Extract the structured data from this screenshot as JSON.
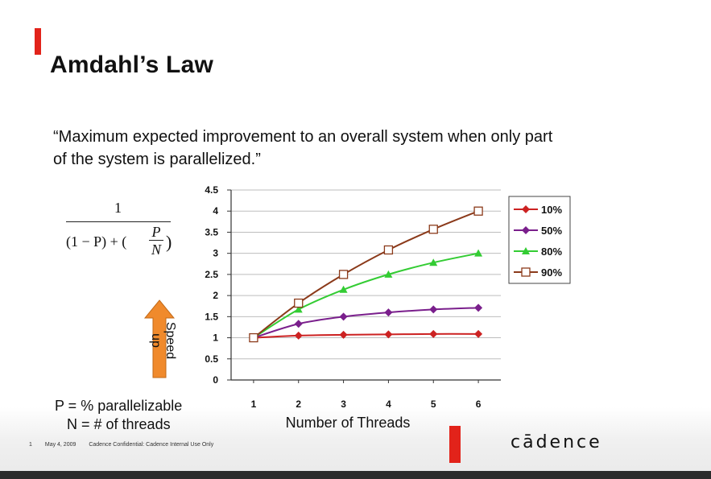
{
  "slide": {
    "title": "Amdahl’s Law",
    "quote": "“Maximum expected improvement to an overall system when only part of the system is parallelized.”",
    "formula": {
      "numerator": "1",
      "denominator_left": "(1 − P) + (",
      "denominator_right": ")",
      "fraction_top": "P",
      "fraction_bottom": "N"
    },
    "speed_label": "Speed up",
    "definition_p": "P = % parallelizable",
    "definition_n": "N = # of threads",
    "footer_date": "May 4, 2009",
    "footer_confidential": "Cadence Confidential: Cadence Internal Use Only",
    "footer_page": "1",
    "logo": "cādence"
  },
  "colors": {
    "accent": "#e2231a",
    "arrow": "#f08a2c"
  },
  "chart_data": {
    "type": "line",
    "title": "",
    "xlabel": "Number of Threads",
    "ylabel": "",
    "x": [
      1,
      2,
      3,
      4,
      5,
      6
    ],
    "ylim": [
      0,
      4.5
    ],
    "yticks": [
      "0",
      "0.5",
      "1",
      "1.5",
      "2",
      "2.5",
      "3",
      "3.5",
      "4",
      "4.5"
    ],
    "xticks": [
      "1",
      "2",
      "3",
      "4",
      "5",
      "6"
    ],
    "grid": true,
    "legend_position": "right",
    "series": [
      {
        "name": "10%",
        "color": "#cc2222",
        "marker": "diamond",
        "values": [
          1.0,
          1.05,
          1.07,
          1.08,
          1.09,
          1.09
        ]
      },
      {
        "name": "50%",
        "color": "#7a1f8c",
        "marker": "diamond",
        "values": [
          1.0,
          1.33,
          1.5,
          1.6,
          1.67,
          1.71
        ]
      },
      {
        "name": "80%",
        "color": "#33cc33",
        "marker": "triangle",
        "values": [
          1.0,
          1.67,
          2.14,
          2.5,
          2.78,
          3.0
        ]
      },
      {
        "name": "90%",
        "color": "#8b3a1a",
        "marker": "square",
        "values": [
          1.0,
          1.82,
          2.5,
          3.08,
          3.57,
          4.0
        ]
      }
    ]
  }
}
